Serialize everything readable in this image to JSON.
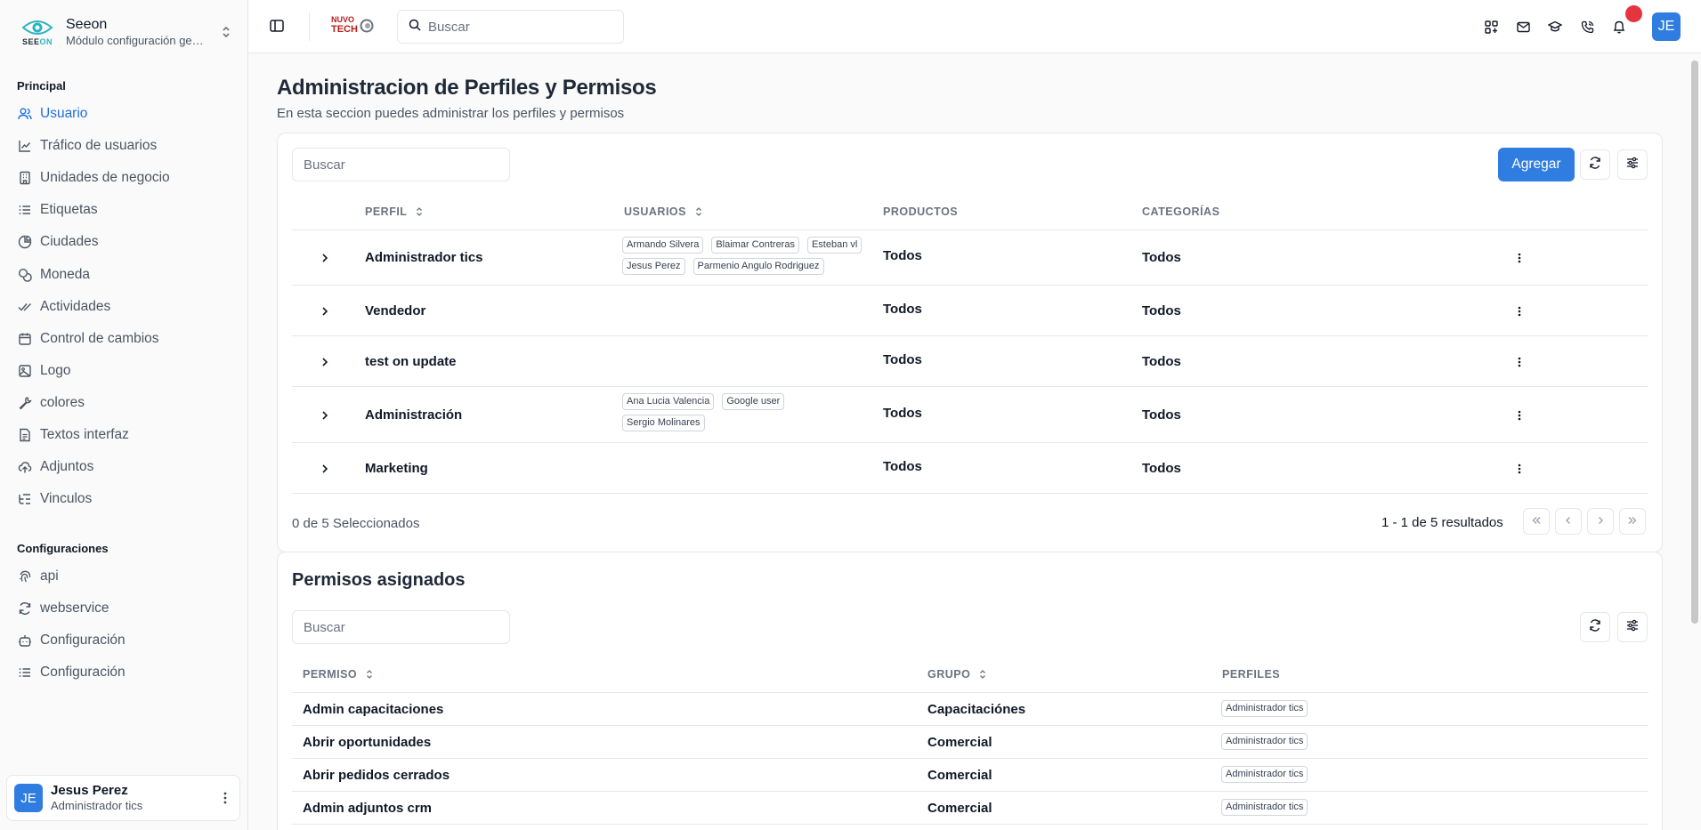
{
  "brand": {
    "name": "Seeon",
    "subtitle": "Módulo configuración general"
  },
  "tenant_logo": {
    "line1": "NUVO",
    "line2": "TECH"
  },
  "sidebar": {
    "group_principal": "Principal",
    "items": [
      {
        "label": "Usuario",
        "icon": "users-icon",
        "active": true
      },
      {
        "label": "Tráfico de usuarios",
        "icon": "line-chart-icon"
      },
      {
        "label": "Unidades de negocio",
        "icon": "building-icon"
      },
      {
        "label": "Etiquetas",
        "icon": "list-icon"
      },
      {
        "label": "Ciudades",
        "icon": "pie-chart-icon"
      },
      {
        "label": "Moneda",
        "icon": "coins-icon"
      },
      {
        "label": "Actividades",
        "icon": "check-check-icon"
      },
      {
        "label": "Control de cambios",
        "icon": "calendar-icon"
      },
      {
        "label": "Logo",
        "icon": "image-icon"
      },
      {
        "label": "colores",
        "icon": "wrench-icon"
      },
      {
        "label": "Textos interfaz",
        "icon": "file-text-icon"
      },
      {
        "label": "Adjuntos",
        "icon": "upload-cloud-icon"
      },
      {
        "label": "Vinculos",
        "icon": "list-tree-icon"
      }
    ],
    "group_config": "Configuraciones",
    "config_items": [
      {
        "label": "api",
        "icon": "fingerprint-icon"
      },
      {
        "label": "webservice",
        "icon": "refresh-icon"
      },
      {
        "label": "Configuración",
        "icon": "bot-icon"
      },
      {
        "label": "Configuración",
        "icon": "list-icon"
      }
    ]
  },
  "user": {
    "initials": "JE",
    "name": "Jesus Perez",
    "role": "Administrador tics"
  },
  "header": {
    "search_placeholder": "Buscar",
    "avatar": "JE"
  },
  "page": {
    "title": "Administracion de Perfiles y Permisos",
    "subtitle": "En esta seccion puedes administrar los perfiles y permisos"
  },
  "profiles": {
    "search_placeholder": "Buscar",
    "add_label": "Agregar",
    "columns": {
      "perfil": "PERFIL",
      "usuarios": "USUARIOS",
      "productos": "PRODUCTOS",
      "categorias": "CATEGORÍAS"
    },
    "rows": [
      {
        "perfil": "Administrador tics",
        "usuarios": [
          "Armando Silvera",
          "Blaimar Contreras",
          "Esteban vl",
          "Jesus Perez",
          "Parmenio Angulo Rodriguez"
        ],
        "productos": "Todos",
        "categorias": "Todos"
      },
      {
        "perfil": "Vendedor",
        "usuarios": [],
        "productos": "Todos",
        "categorias": "Todos"
      },
      {
        "perfil": "test on update",
        "usuarios": [],
        "productos": "Todos",
        "categorias": "Todos"
      },
      {
        "perfil": "Administración",
        "usuarios": [
          "Ana Lucia Valencia",
          "Google user",
          "Sergio Molinares"
        ],
        "productos": "Todos",
        "categorias": "Todos"
      },
      {
        "perfil": "Marketing",
        "usuarios": [],
        "productos": "Todos",
        "categorias": "Todos"
      }
    ],
    "selected_text": "0 de 5 Seleccionados",
    "results_text": "1 - 1 de 5 resultados"
  },
  "permissions": {
    "title": "Permisos asignados",
    "search_placeholder": "Buscar",
    "columns": {
      "permiso": "PERMISO",
      "grupo": "GRUPO",
      "perfiles": "PERFILES"
    },
    "rows": [
      {
        "permiso": "Admin capacitaciones",
        "grupo": "Capacitaciónes",
        "perfil": "Administrador tics"
      },
      {
        "permiso": "Abrir oportunidades",
        "grupo": "Comercial",
        "perfil": "Administrador tics"
      },
      {
        "permiso": "Abrir pedidos cerrados",
        "grupo": "Comercial",
        "perfil": "Administrador tics"
      },
      {
        "permiso": "Admin adjuntos crm",
        "grupo": "Comercial",
        "perfil": "Administrador tics"
      }
    ]
  },
  "colors": {
    "accent": "#2f7de1",
    "notification": "#e5343d",
    "active_nav": "#1d6fe8"
  }
}
